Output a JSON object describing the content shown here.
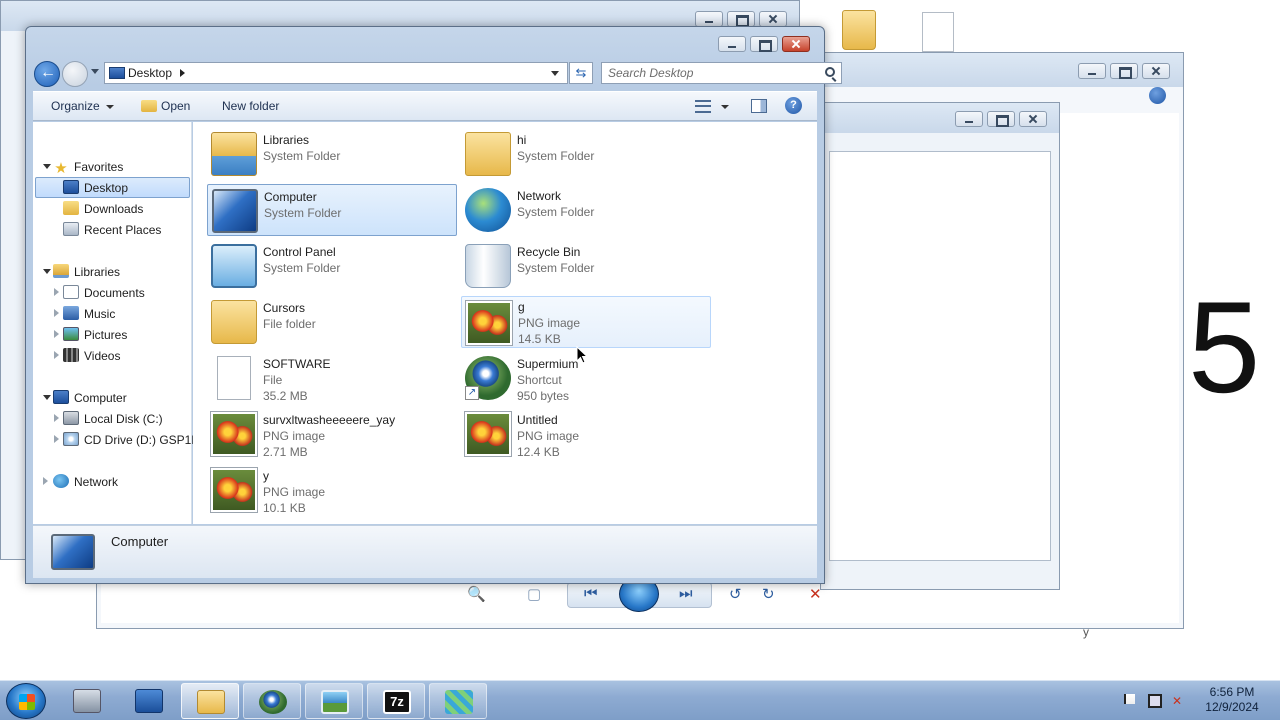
{
  "explorer": {
    "address": "Desktop",
    "search_placeholder": "Search Desktop",
    "toolbar": {
      "organize": "Organize",
      "open": "Open",
      "new_folder": "New folder"
    },
    "nav": {
      "favorites": "Favorites",
      "desktop": "Desktop",
      "downloads": "Downloads",
      "recent_places": "Recent Places",
      "libraries": "Libraries",
      "documents": "Documents",
      "music": "Music",
      "pictures": "Pictures",
      "videos": "Videos",
      "computer": "Computer",
      "local_disk": "Local Disk (C:)",
      "cd_drive": "CD Drive (D:) GSP1R",
      "network": "Network"
    },
    "items": [
      {
        "name": "Libraries",
        "type": "System Folder",
        "size": ""
      },
      {
        "name": "hi",
        "type": "System Folder",
        "size": ""
      },
      {
        "name": "Computer",
        "type": "System Folder",
        "size": ""
      },
      {
        "name": "Network",
        "type": "System Folder",
        "size": ""
      },
      {
        "name": "Control Panel",
        "type": "System Folder",
        "size": ""
      },
      {
        "name": "Recycle Bin",
        "type": "System Folder",
        "size": ""
      },
      {
        "name": "Cursors",
        "type": "File folder",
        "size": ""
      },
      {
        "name": "g",
        "type": "PNG image",
        "size": "14.5 KB"
      },
      {
        "name": "SOFTWARE",
        "type": "File",
        "size": "35.2 MB"
      },
      {
        "name": "Supermium",
        "type": "Shortcut",
        "size": "950 bytes"
      },
      {
        "name": "survxltwasheeeeere_yay",
        "type": "PNG image",
        "size": "2.71 MB"
      },
      {
        "name": "Untitled",
        "type": "PNG image",
        "size": "12.4 KB"
      },
      {
        "name": "y",
        "type": "PNG image",
        "size": "10.1 KB"
      }
    ],
    "details_label": "Computer"
  },
  "overlay": {
    "big_number": "5",
    "small_text": "y"
  },
  "taskbar": {
    "time": "6:56 PM",
    "date": "12/9/2024"
  },
  "icons": {
    "back": "back-arrow-icon",
    "forward": "forward-arrow-icon",
    "search": "search-icon",
    "help": "help-icon"
  }
}
